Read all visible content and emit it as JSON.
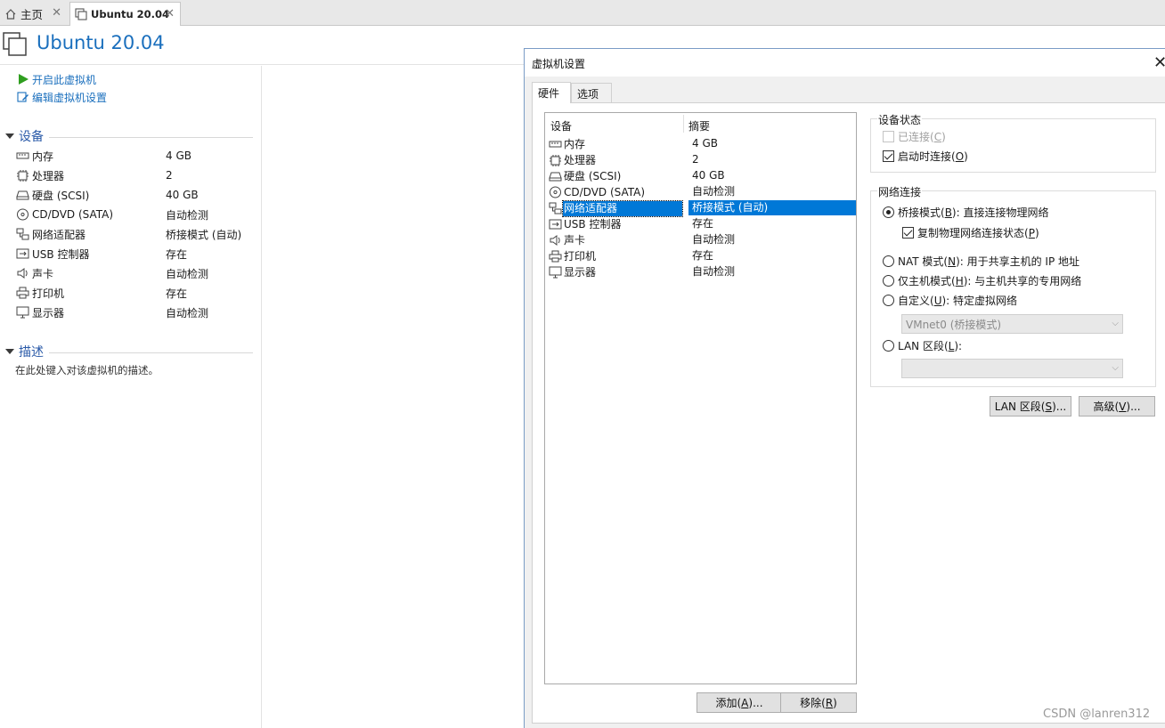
{
  "tabs": {
    "home_label": "主页",
    "vm_label": "Ubuntu 20.04"
  },
  "vm": {
    "title": "Ubuntu 20.04",
    "actions": {
      "power_on": "开启此虚拟机",
      "edit_settings": "编辑虚拟机设置"
    },
    "devices_section": "设备",
    "devices": [
      {
        "name": "内存",
        "value": "4 GB",
        "icon": "memory-icon"
      },
      {
        "name": "处理器",
        "value": "2",
        "icon": "processor-icon"
      },
      {
        "name": "硬盘 (SCSI)",
        "value": "40 GB",
        "icon": "hard-disk-icon"
      },
      {
        "name": "CD/DVD (SATA)",
        "value": "自动检测",
        "icon": "cd-dvd-icon"
      },
      {
        "name": "网络适配器",
        "value": "桥接模式 (自动)",
        "icon": "network-adapter-icon"
      },
      {
        "name": "USB 控制器",
        "value": "存在",
        "icon": "usb-icon"
      },
      {
        "name": "声卡",
        "value": "自动检测",
        "icon": "sound-card-icon"
      },
      {
        "name": "打印机",
        "value": "存在",
        "icon": "printer-icon"
      },
      {
        "name": "显示器",
        "value": "自动检测",
        "icon": "display-icon"
      }
    ],
    "description_section": "描述",
    "description_placeholder": "在此处键入对该虚拟机的描述。"
  },
  "dialog": {
    "title": "虚拟机设置",
    "tabs": {
      "hardware": "硬件",
      "options": "选项"
    },
    "list_header": {
      "device": "设备",
      "summary": "摘要"
    },
    "devices": [
      {
        "name": "内存",
        "value": "4 GB",
        "icon": "memory-icon",
        "selected": false
      },
      {
        "name": "处理器",
        "value": "2",
        "icon": "processor-icon",
        "selected": false
      },
      {
        "name": "硬盘 (SCSI)",
        "value": "40 GB",
        "icon": "hard-disk-icon",
        "selected": false
      },
      {
        "name": "CD/DVD (SATA)",
        "value": "自动检测",
        "icon": "cd-dvd-icon",
        "selected": false
      },
      {
        "name": "网络适配器",
        "value": "桥接模式 (自动)",
        "icon": "network-adapter-icon",
        "selected": true
      },
      {
        "name": "USB 控制器",
        "value": "存在",
        "icon": "usb-icon",
        "selected": false
      },
      {
        "name": "声卡",
        "value": "自动检测",
        "icon": "sound-card-icon",
        "selected": false
      },
      {
        "name": "打印机",
        "value": "存在",
        "icon": "printer-icon",
        "selected": false
      },
      {
        "name": "显示器",
        "value": "自动检测",
        "icon": "display-icon",
        "selected": false
      }
    ],
    "add_button": {
      "text": "添加(",
      "key": "A",
      "tail": ")..."
    },
    "remove_button": {
      "text": "移除(",
      "key": "R",
      "tail": ")"
    },
    "device_status": {
      "label": "设备状态",
      "connected": {
        "text": "已连接(",
        "key": "C",
        "tail": ")",
        "checked": false,
        "enabled": false
      },
      "connect_at_power_on": {
        "text": "启动时连接(",
        "key": "O",
        "tail": ")",
        "checked": true,
        "enabled": true
      }
    },
    "network_connection": {
      "label": "网络连接",
      "bridged": {
        "text": "桥接模式(",
        "key": "B",
        "tail": "): 直接连接物理网络",
        "selected": true
      },
      "replicate": {
        "text": "复制物理网络连接状态(",
        "key": "P",
        "tail": ")",
        "checked": true
      },
      "nat": {
        "text": "NAT 模式(",
        "key": "N",
        "tail": "): 用于共享主机的 IP 地址",
        "selected": false
      },
      "host_only": {
        "text": "仅主机模式(",
        "key": "H",
        "tail": "): 与主机共享的专用网络",
        "selected": false
      },
      "custom": {
        "text": "自定义(",
        "key": "U",
        "tail": "): 特定虚拟网络",
        "selected": false
      },
      "custom_select": "VMnet0 (桥接模式)",
      "lan_segment": {
        "text": "LAN 区段(",
        "key": "L",
        "tail": "):",
        "selected": false
      },
      "lan_select": ""
    },
    "lan_segments_button": {
      "text": "LAN 区段(",
      "key": "S",
      "tail": ")..."
    },
    "advanced_button": {
      "text": "高级(",
      "key": "V",
      "tail": ")..."
    }
  },
  "watermark": "CSDN @lanren312",
  "colors": {
    "accent": "#1a6fbd",
    "selection": "#0078d7",
    "section": "#2a5aa8"
  }
}
